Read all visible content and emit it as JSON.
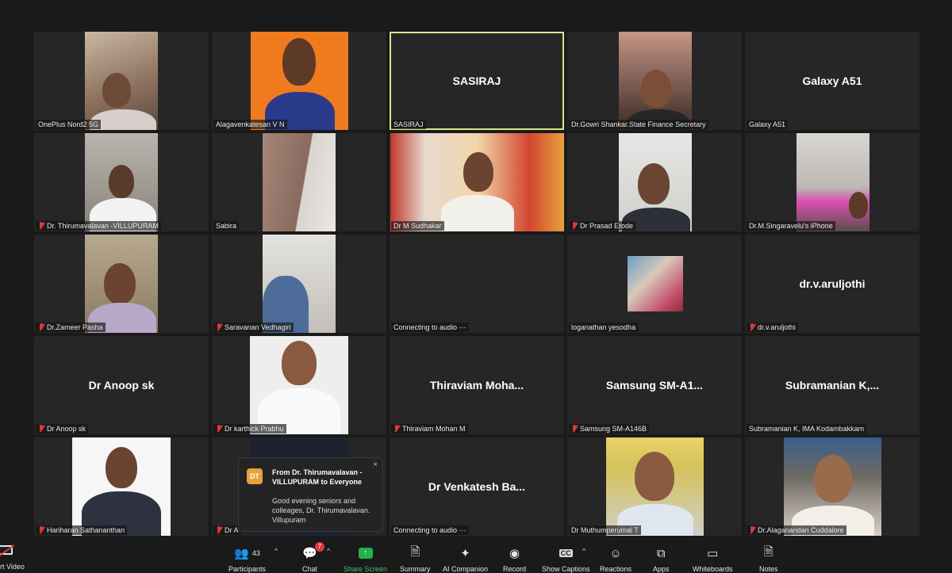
{
  "tiles": [
    {
      "label": "OnePlus Nord2 5G"
    },
    {
      "label": "Alagavenkatesan V N"
    },
    {
      "label": "SASIRAJ",
      "big": "SASIRAJ"
    },
    {
      "label": "Dr.Gowri Shankar.State Finance Secretary"
    },
    {
      "label": "Galaxy A51",
      "big": "Galaxy A51"
    },
    {
      "label": "Dr. Thirumavalavan -VILLUPURAM"
    },
    {
      "label": "Sabira"
    },
    {
      "label": "Dr M Sudhakar"
    },
    {
      "label": "Dr Prasad Erode"
    },
    {
      "label": "Dr.M.Singaravelu's iPhone"
    },
    {
      "label": "Dr.Zameer Pasha"
    },
    {
      "label": "Saravanan Vedhagiri"
    },
    {
      "label": "Connecting to audio ⋯"
    },
    {
      "label": "loganathan yesodha"
    },
    {
      "label": "dr.v.aruljothi",
      "big": "dr.v.aruljothi"
    },
    {
      "label": "Dr Anoop sk",
      "big": "Dr Anoop sk"
    },
    {
      "label": "Dr karthick Prabhu"
    },
    {
      "label": "Thiraviam Mohan M",
      "big": "Thiraviam  Moha..."
    },
    {
      "label": "Samsung SM-A146B",
      "big": "Samsung  SM-A1..."
    },
    {
      "label": "Subramanian K, IMA Kodambakkam",
      "big": "Subramanian  K,..."
    },
    {
      "label": "Hariharan Sathananthan"
    },
    {
      "label": "Dr A"
    },
    {
      "label": "Connecting to audio ⋯",
      "big": "Dr  Venkatesh  Ba..."
    },
    {
      "label": "Dr  Muthumperumal T"
    },
    {
      "label": "Dr.Alaganandan Cuddalore"
    }
  ],
  "chat": {
    "avatar": "DT",
    "from": "From Dr. Thirumavalavan - VILLUPURAM to Everyone",
    "message": "Good evening seniors and colleages, Dr. Thirumavalavan. Villupuram",
    "close": "×"
  },
  "toolbar": {
    "start_video": "rt Video",
    "participants": "Participants",
    "participants_count": "43",
    "chat": "Chat",
    "chat_badge": "7",
    "share_screen": "Share Screen",
    "summary": "Summary",
    "ai_companion": "AI Companion",
    "record": "Record",
    "show_captions": "Show Captions",
    "cc": "CC",
    "reactions": "Reactions",
    "apps": "Apps",
    "whiteboards": "Whiteboards",
    "notes": "Notes",
    "caret": "^"
  },
  "colors": {
    "background": "#1a1a1a",
    "tile": "#262626",
    "active_border": "#d6e88c",
    "muted_red": "#e0383a",
    "share_green": "#22b14c"
  }
}
